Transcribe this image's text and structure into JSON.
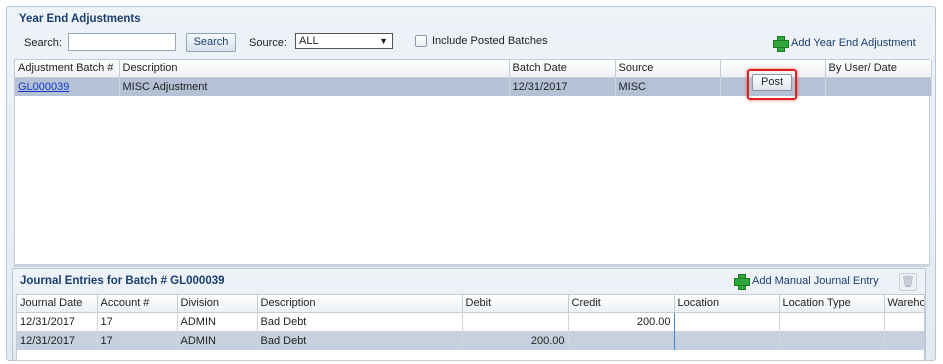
{
  "panel": {
    "title": "Year End Adjustments",
    "search_label": "Search:",
    "search_value": "",
    "search_button": "Search",
    "source_label": "Source:",
    "source_value": "ALL",
    "include_posted_label": "Include Posted Batches",
    "include_posted_checked": false,
    "add_button": "Add Year End Adjustment"
  },
  "batches": {
    "columns": [
      "Adjustment Batch #",
      "Description",
      "Batch Date",
      "Source",
      "",
      "By User/ Date"
    ],
    "rows": [
      {
        "batch": "GL000039",
        "description": "MISC Adjustment",
        "date": "12/31/2017",
        "source": "MISC",
        "action": "Post",
        "by_user": ""
      }
    ]
  },
  "journal": {
    "title": "Journal Entries for Batch # GL000039",
    "add_button": "Add Manual Journal Entry",
    "columns": [
      "Journal Date",
      "Account #",
      "Division",
      "Description",
      "Debit",
      "Credit",
      "Location",
      "Location Type",
      "Warehou"
    ],
    "rows": [
      {
        "date": "12/31/2017",
        "account": "17",
        "division": "ADMIN",
        "description": "Bad Debt",
        "debit": "",
        "credit": "200.00",
        "location": "",
        "location_type": "",
        "warehouse": ""
      },
      {
        "date": "12/31/2017",
        "account": "17",
        "division": "ADMIN",
        "description": "Bad Debt",
        "debit": "200.00",
        "credit": "",
        "location": "",
        "location_type": "",
        "warehouse": ""
      }
    ]
  },
  "colors": {
    "title": "#1a3e6e",
    "selected_row": "#b5c2d6",
    "highlight": "#e0201f",
    "add_icon": "#2fa73a"
  },
  "icons": [
    "plus-icon",
    "trash-icon",
    "chevron-down-icon"
  ]
}
